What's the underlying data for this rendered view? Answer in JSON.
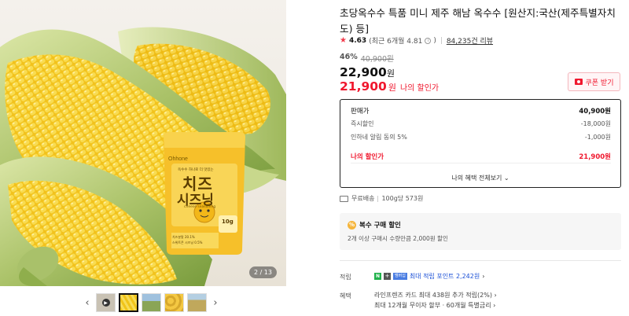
{
  "gallery": {
    "counter": "2 / 13",
    "product_bag": {
      "brand": "Ohhone",
      "top_text": "옥수수 하나로 더 맛있는",
      "main_line1": "치즈",
      "main_line2": "시즈닝",
      "sub_text": "cheese seasoning",
      "weight": "10g",
      "footnote1": "치즈분말 20.1%",
      "footnote2": "스위트콘 시즈닝 0.5%"
    },
    "thumbnails": [
      "video",
      "corn-closeup",
      "field",
      "corn-pile",
      "field-2"
    ]
  },
  "product": {
    "title": "초당옥수수 특품 미니 제주 해남 옥수수 [원산지:국산(제주특별자치도) 등]",
    "rating": "4.63",
    "recent_rating": "(최근 6개월 4.81",
    "recent_rating_close": ")",
    "reviews": "84,235건 리뷰",
    "discount_rate": "46%",
    "original_price": "40,900원",
    "sale_price": "22,900",
    "my_price": "21,900",
    "won": "원",
    "my_price_label": "나의 할인가",
    "coupon_label": "쿠폰 받기"
  },
  "price_box": {
    "rows": [
      {
        "label": "판매가",
        "value": "40,900원"
      },
      {
        "label": "즉시할인",
        "value": "-18,000원"
      },
      {
        "label": "인하네 알림 동의 5%",
        "value": "-1,000원"
      }
    ],
    "my_label": "나의 할인가",
    "my_value": "21,900원",
    "view_all": "나의 혜택 전체보기",
    "view_all_chevron": "⌄"
  },
  "shipping": {
    "label": "무료배송",
    "unit_price": "100g당 573원"
  },
  "multi_buy": {
    "title": "복수 구매 할인",
    "desc": "2개 이상 구매시 수량만큼 2,000원 할인"
  },
  "points": {
    "label": "적립",
    "text": "최대 적립 포인트 2,242원",
    "chevron": "›",
    "badge_n": "N",
    "badge_plus": "+",
    "badge_hd": "멤버십"
  },
  "benefits": {
    "label": "혜택",
    "line1": "라인프렌즈 카드 최대 438원 추가 적립(2%)",
    "line1_chevron": "›",
    "line2": "최대 12개월 무이자 할부 · 60개월 특별금리",
    "line2_chevron": "›"
  },
  "colors": {
    "accent_red": "#f0182e",
    "point_blue": "#1a4fd6",
    "naver_green": "#22b24c"
  }
}
